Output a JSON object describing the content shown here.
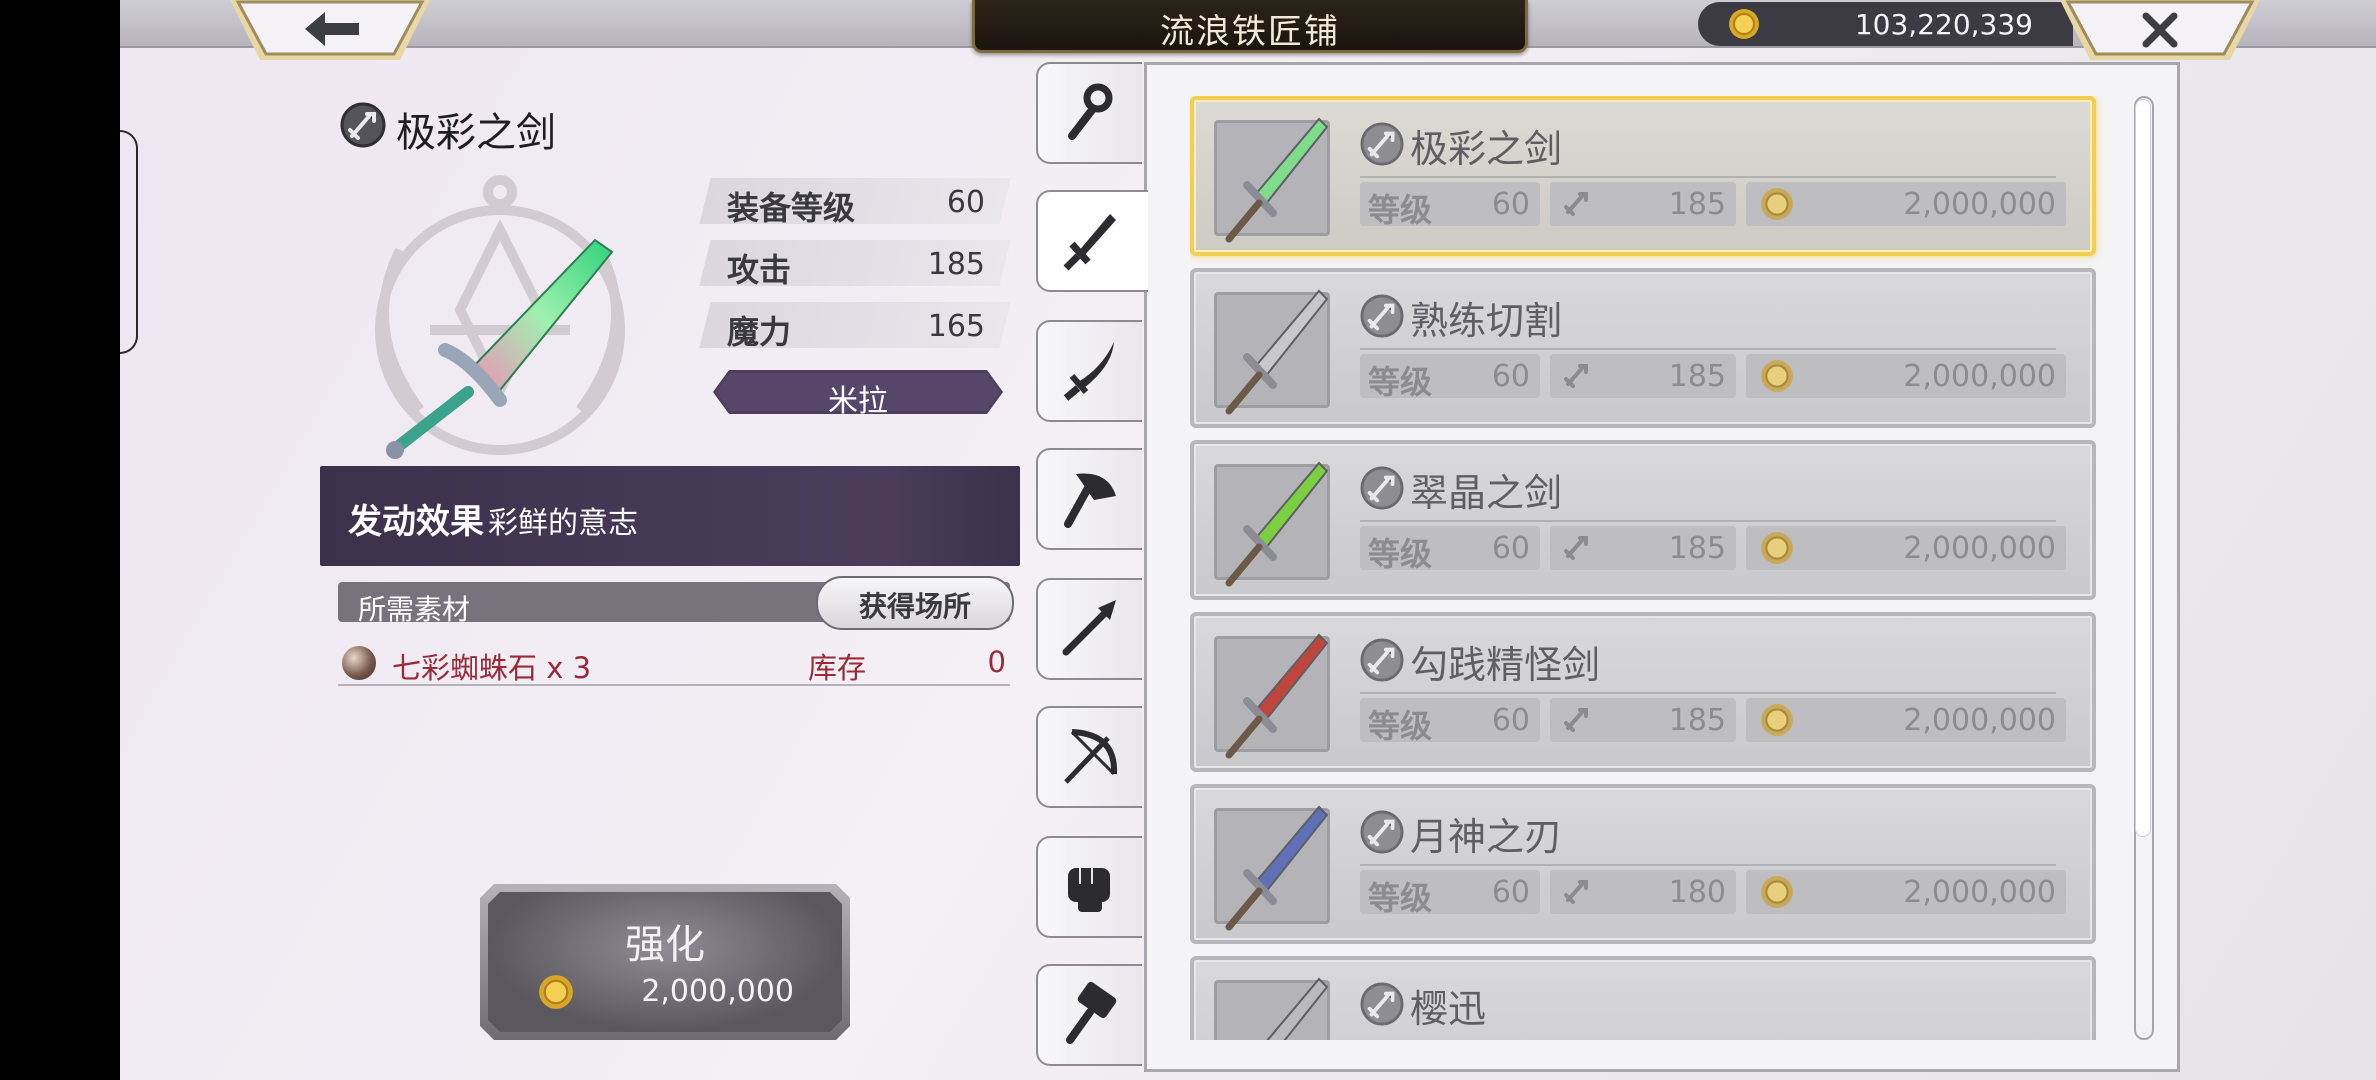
{
  "header": {
    "title": "流浪铁匠铺",
    "currency_amount": "103,220,339",
    "back_glyph": "🡐",
    "close_glyph": "✕"
  },
  "detail": {
    "item_name": "极彩之剑",
    "stats": [
      {
        "label": "装备等级",
        "value": "60"
      },
      {
        "label": "攻击",
        "value": "185"
      },
      {
        "label": "魔力",
        "value": "165"
      }
    ],
    "owner": "米拉",
    "effect_label": "发动效果",
    "effect_value": "彩鲜的意志",
    "materials_label": "所需素材",
    "source_button": "获得场所",
    "material_name": "七彩蜘蛛石 x 3",
    "stock_label": "库存",
    "stock_count": "0"
  },
  "enhance": {
    "label": "强化",
    "cost": "2,000,000"
  },
  "tabs": [
    "staff-icon",
    "sword-icon",
    "katana-icon",
    "axe-icon",
    "spear-icon",
    "bow-icon",
    "fist-icon",
    "hammer-icon"
  ],
  "items": [
    {
      "name": "极彩之剑",
      "level_label": "等级",
      "level": "60",
      "attack": "185",
      "price": "2,000,000",
      "blade": "#7fdc8a",
      "selected": true
    },
    {
      "name": "熟练切割",
      "level_label": "等级",
      "level": "60",
      "attack": "185",
      "price": "2,000,000",
      "blade": "#c8c8cc",
      "selected": false
    },
    {
      "name": "翠晶之剑",
      "level_label": "等级",
      "level": "60",
      "attack": "185",
      "price": "2,000,000",
      "blade": "#7ccf3f",
      "selected": false
    },
    {
      "name": "勾践精怪剑",
      "level_label": "等级",
      "level": "60",
      "attack": "185",
      "price": "2,000,000",
      "blade": "#c0463d",
      "selected": false
    },
    {
      "name": "月神之刃",
      "level_label": "等级",
      "level": "60",
      "attack": "180",
      "price": "2,000,000",
      "blade": "#5f6fb8",
      "selected": false
    },
    {
      "name": "樱迅",
      "level_label": "",
      "level": "",
      "attack": "",
      "price": "",
      "blade": "#b9b9be",
      "selected": false
    }
  ],
  "colors": {
    "accent_purple": "#4a3d5b",
    "gold_highlight": "#f2cf52",
    "material_red": "#9b2a37"
  }
}
